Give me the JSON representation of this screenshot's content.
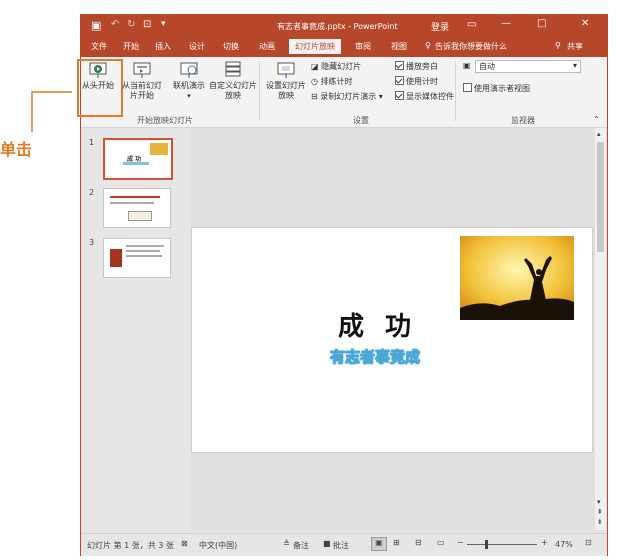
{
  "annotation": {
    "text": "单击",
    "color": "#e07b27"
  },
  "window": {
    "title": "有志者事竟成.pptx - PowerPoint",
    "login": "登录",
    "accent": "#b7472a"
  },
  "tabs": [
    "文件",
    "开始",
    "插入",
    "设计",
    "切换",
    "动画",
    "幻灯片放映",
    "审阅",
    "视图"
  ],
  "active_tab": "幻灯片放映",
  "tell_me": "告诉我你想要做什么",
  "share": "共享",
  "ribbon": {
    "start_group": {
      "from_beginning": "从头开始",
      "from_current": "从当前幻灯片开始",
      "online": "联机演示",
      "custom": "自定义幻灯片放映",
      "label": "开始放映幻灯片"
    },
    "setup_group": {
      "setup": "设置幻灯片放映",
      "hide": "隐藏幻灯片",
      "rehearse": "排练计时",
      "record": "录制幻灯片演示",
      "play_narrations": "播放旁白",
      "use_timings": "使用计时",
      "show_media": "显示媒体控件",
      "label": "设置"
    },
    "monitor_group": {
      "monitor_value": "自动",
      "presenter_view": "使用演示者视图",
      "label": "监视器"
    }
  },
  "slides": [
    {
      "number": "1",
      "selected": true
    },
    {
      "number": "2",
      "selected": false
    },
    {
      "number": "3",
      "selected": false
    }
  ],
  "slide_content": {
    "title": "成  功",
    "subtitle": "有志者事竟成"
  },
  "status": {
    "slide_info": "幻灯片 第 1 张，共 3 张",
    "language": "中文(中国)",
    "notes": "备注",
    "comments": "批注",
    "zoom": "47%"
  }
}
